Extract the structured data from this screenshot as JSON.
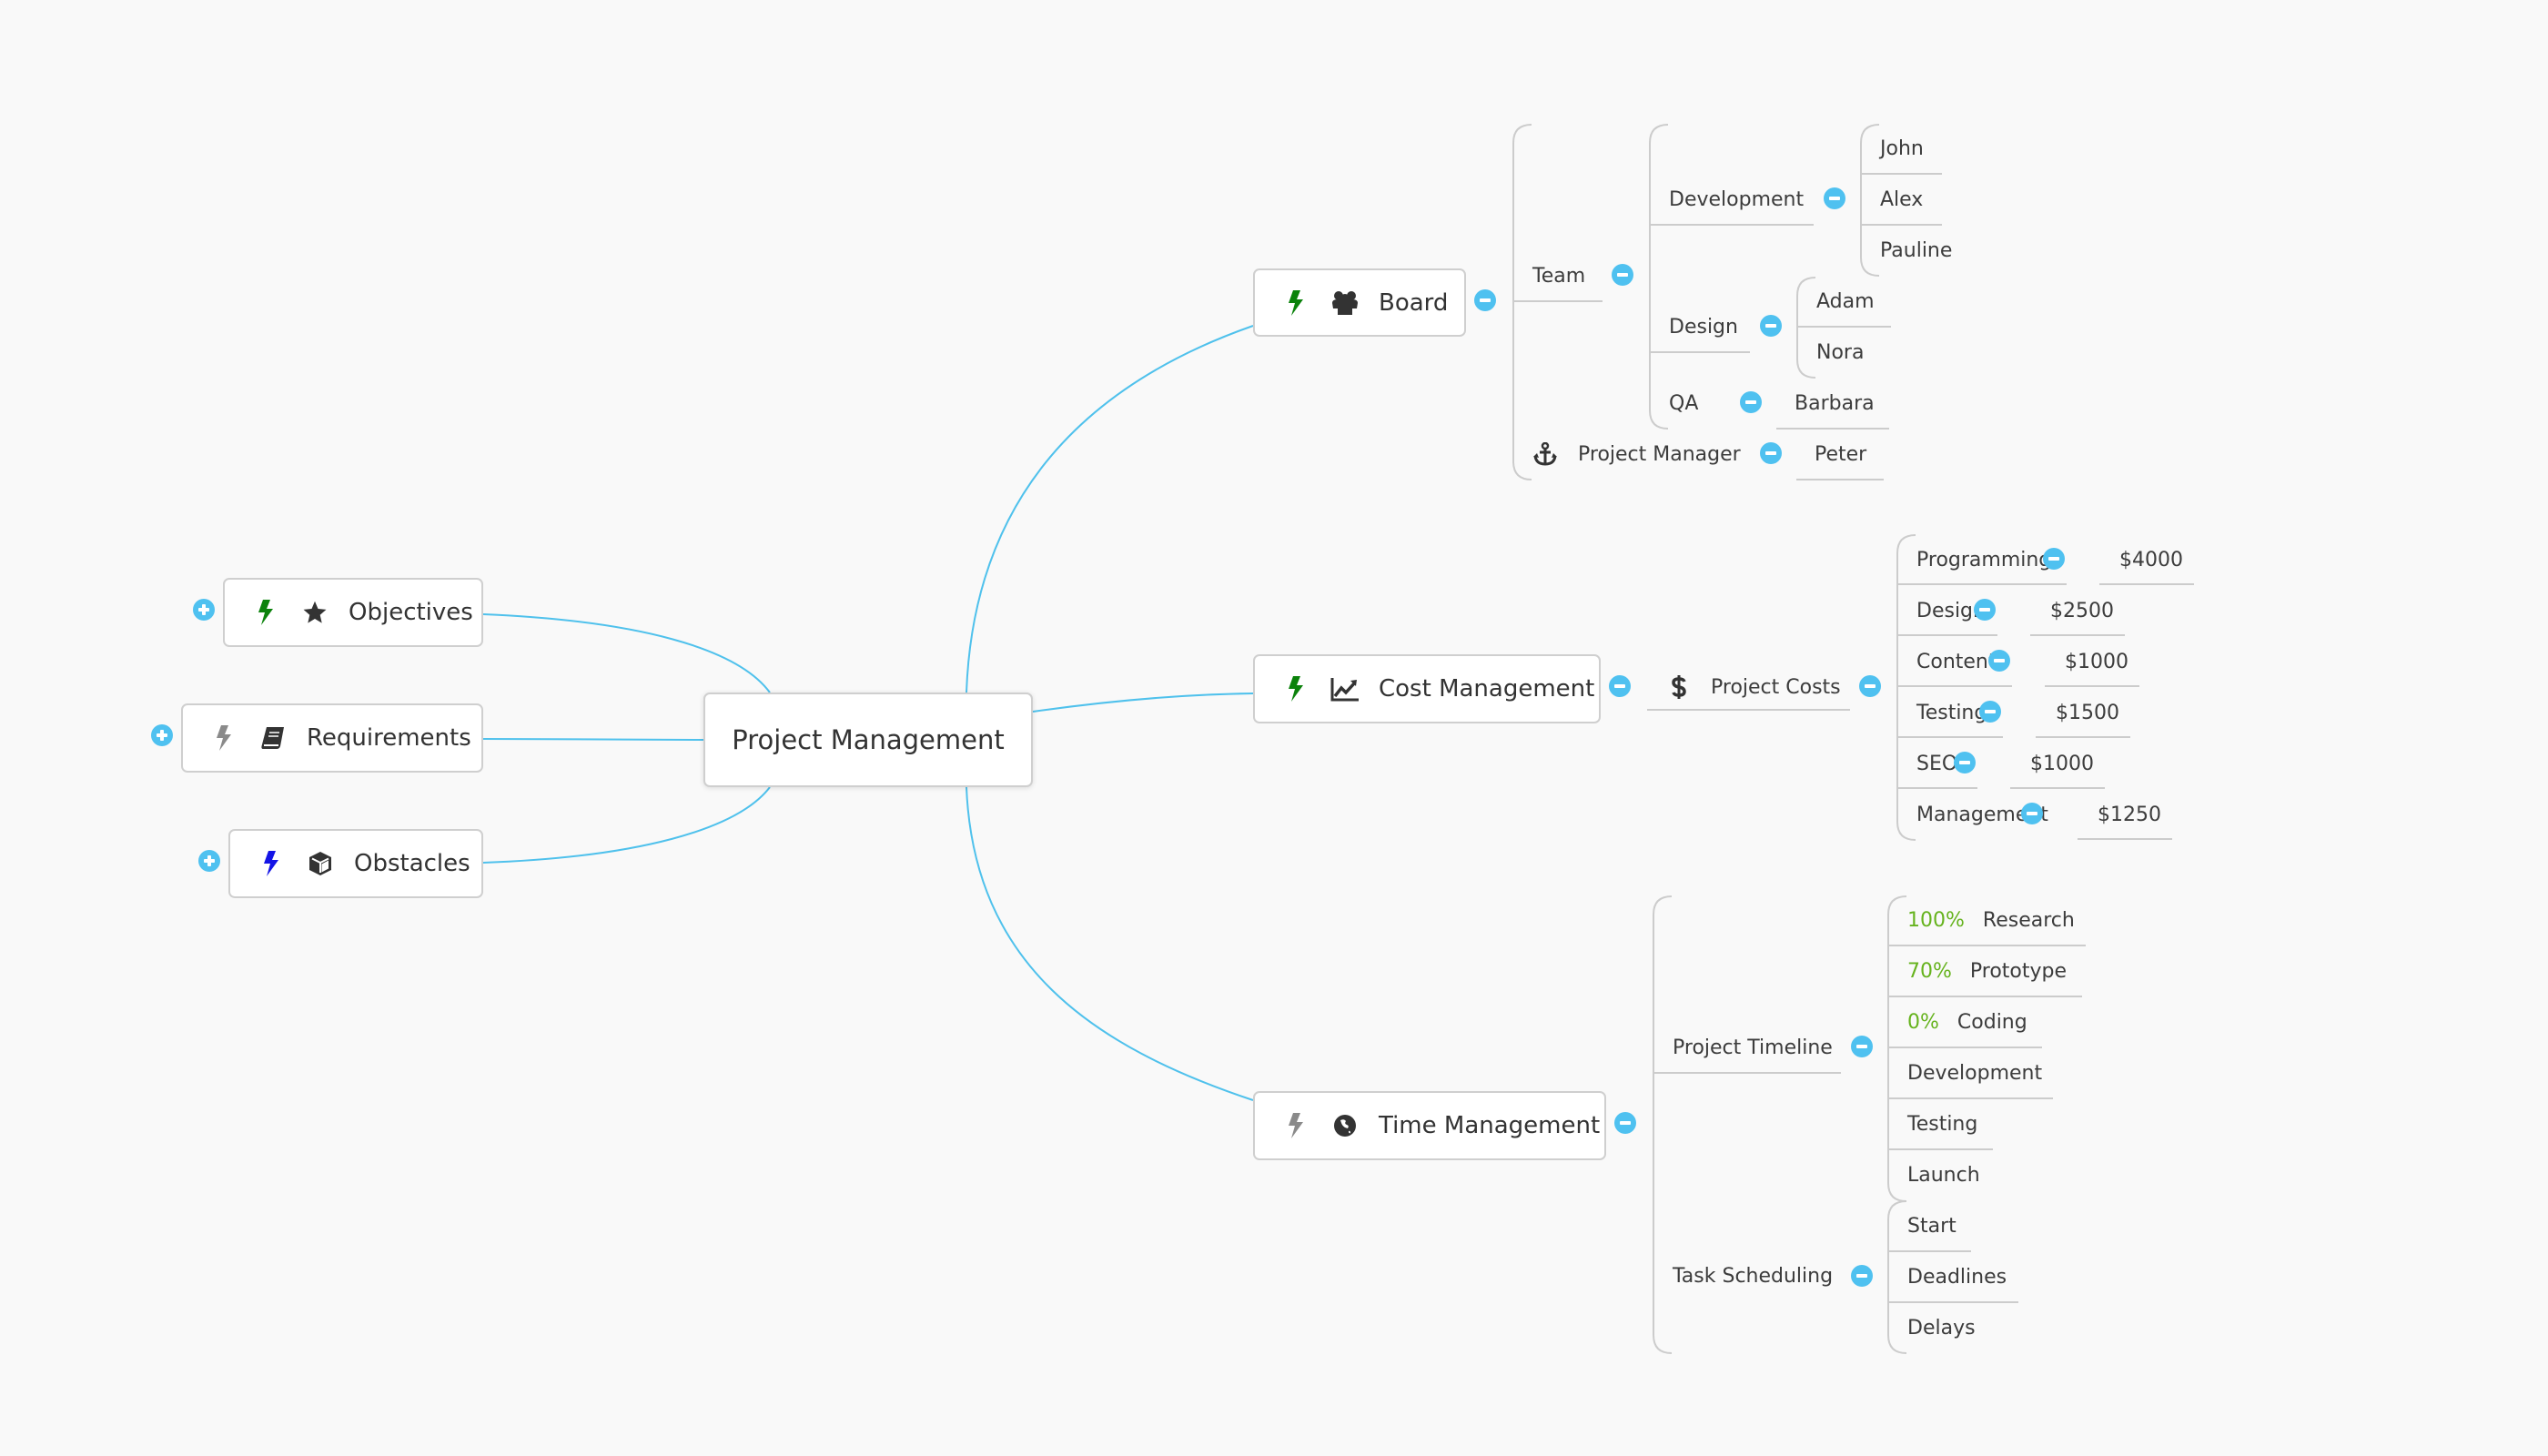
{
  "root": {
    "label": "Project Management"
  },
  "left_topics": [
    {
      "label": "Objectives",
      "bolt_color": "#0b820b",
      "icon": "star-icon",
      "collapsed": true
    },
    {
      "label": "Requirements",
      "bolt_color": "#8a8a8a",
      "icon": "book-icon",
      "collapsed": true
    },
    {
      "label": "Obstacles",
      "bolt_color": "#1414e6",
      "icon": "cube-icon",
      "collapsed": true
    }
  ],
  "board": {
    "label": "Board",
    "bolt_color": "#0b820b",
    "icon": "group-icon",
    "team": {
      "label": "Team",
      "development": {
        "label": "Development",
        "members": [
          "John",
          "Alex",
          "Pauline"
        ]
      },
      "design": {
        "label": "Design",
        "members": [
          "Adam",
          "Nora"
        ]
      },
      "qa": {
        "label": "QA",
        "members": [
          "Barbara"
        ]
      }
    },
    "project_manager": {
      "label": "Project Manager",
      "icon": "anchor-icon",
      "members": [
        "Peter"
      ]
    }
  },
  "cost": {
    "label": "Cost Management",
    "bolt_color": "#0b820b",
    "icon": "line-chart-icon",
    "project_costs": {
      "label": "Project Costs",
      "icon": "dollar-icon",
      "items": [
        {
          "label": "Programming",
          "value": "$4000"
        },
        {
          "label": "Design",
          "value": "$2500"
        },
        {
          "label": "Content",
          "value": "$1000"
        },
        {
          "label": "Testing",
          "value": "$1500"
        },
        {
          "label": "SEO",
          "value": "$1000"
        },
        {
          "label": "Management",
          "value": "$1250"
        }
      ]
    }
  },
  "time": {
    "label": "Time Management",
    "bolt_color": "#8a8a8a",
    "icon": "globe-icon",
    "timeline": {
      "label": "Project Timeline",
      "items": [
        {
          "progress": "100%",
          "label": "Research"
        },
        {
          "progress": "70%",
          "label": "Prototype"
        },
        {
          "progress": "0%",
          "label": "Coding"
        },
        {
          "progress": "",
          "label": "Development"
        },
        {
          "progress": "",
          "label": "Testing"
        },
        {
          "progress": "",
          "label": "Launch"
        }
      ]
    },
    "scheduling": {
      "label": "Task Scheduling",
      "items": [
        "Start",
        "Deadlines",
        "Delays"
      ]
    }
  },
  "colors": {
    "connector": "#4fc1ec",
    "bracket": "#cccccc",
    "toggle": "#4fc1f0",
    "progress": "#66b31e",
    "background": "#f9f9f9"
  }
}
